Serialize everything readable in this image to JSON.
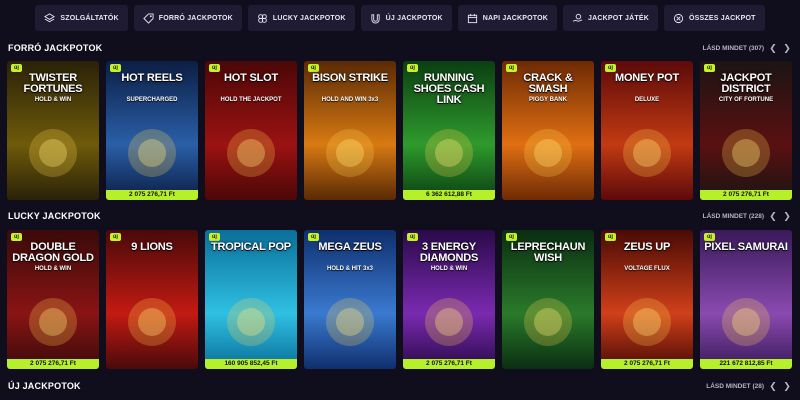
{
  "nav": [
    {
      "label": "SZOLGÁLTATÓK",
      "icon": "layers-icon"
    },
    {
      "label": "FORRÓ JACKPOTOK",
      "icon": "fire-tag-icon"
    },
    {
      "label": "LUCKY JACKPOTOK",
      "icon": "clover-icon"
    },
    {
      "label": "ÚJ JACKPOTOK",
      "icon": "magnet-icon"
    },
    {
      "label": "NAPI JACKPOTOK",
      "icon": "calendar-icon"
    },
    {
      "label": "JACKPOT JÁTÉK",
      "icon": "hand-coin-icon"
    },
    {
      "label": "ÖSSZES JACKPOT",
      "icon": "chip-icon"
    }
  ],
  "sections": [
    {
      "title": "FORRÓ JACKPOTOK",
      "see_all": "LÁSD MINDET (307)",
      "games": [
        {
          "title": "TWISTER FORTUNES",
          "subtitle": "HOLD & WIN",
          "badge": "új",
          "jackpot": "",
          "colors": [
            "#2a2208",
            "#6e5a0a"
          ]
        },
        {
          "title": "HOT REELS",
          "subtitle": "SUPERCHARGED",
          "badge": "új",
          "jackpot": "2 075 276,71 Ft",
          "colors": [
            "#0c1e44",
            "#2a5fa8"
          ]
        },
        {
          "title": "HOT SLOT",
          "subtitle": "HOLD THE JACKPOT",
          "badge": "új",
          "jackpot": "",
          "colors": [
            "#4b0707",
            "#9c1212"
          ]
        },
        {
          "title": "BISON STRIKE",
          "subtitle": "HOLD AND WIN 3x3",
          "badge": "új",
          "jackpot": "",
          "colors": [
            "#5a2a05",
            "#d87a12"
          ]
        },
        {
          "title": "RUNNING SHOES CASH LINK",
          "subtitle": "",
          "badge": "új",
          "jackpot": "6 362 612,88 Ft",
          "colors": [
            "#0b3f12",
            "#2f9a2c"
          ]
        },
        {
          "title": "CRACK & SMASH",
          "subtitle": "PIGGY BANK",
          "badge": "új",
          "jackpot": "",
          "colors": [
            "#6e2a05",
            "#e06f12"
          ]
        },
        {
          "title": "MONEY POT",
          "subtitle": "DELUXE",
          "badge": "új",
          "jackpot": "",
          "colors": [
            "#5c0a0a",
            "#c23a12"
          ]
        },
        {
          "title": "JACKPOT DISTRICT",
          "subtitle": "CITY OF FORTUNE",
          "badge": "új",
          "jackpot": "2 075 276,71 Ft",
          "colors": [
            "#1c1414",
            "#5a1010"
          ]
        }
      ]
    },
    {
      "title": "LUCKY JACKPOTOK",
      "see_all": "LÁSD MINDET (228)",
      "games": [
        {
          "title": "DOUBLE DRAGON GOLD",
          "subtitle": "HOLD & WIN",
          "badge": "új",
          "jackpot": "2 075 276,71 Ft",
          "colors": [
            "#3a0a0a",
            "#8a1414"
          ]
        },
        {
          "title": "9 LIONS",
          "subtitle": "",
          "badge": "új",
          "jackpot": "",
          "colors": [
            "#4a0a0a",
            "#c21a12"
          ]
        },
        {
          "title": "TROPICAL POP",
          "subtitle": "",
          "badge": "új",
          "jackpot": "160 905 852,45 Ft",
          "colors": [
            "#0a6f9a",
            "#2fc0e2"
          ]
        },
        {
          "title": "MEGA ZEUS",
          "subtitle": "HOLD & HIT 3x3",
          "badge": "új",
          "jackpot": "",
          "colors": [
            "#0f2f6e",
            "#3a7ad0"
          ]
        },
        {
          "title": "3 ENERGY DIAMONDS",
          "subtitle": "HOLD & WIN",
          "badge": "új",
          "jackpot": "2 075 276,71 Ft",
          "colors": [
            "#2a0a4a",
            "#7a2ab0"
          ]
        },
        {
          "title": "LEPRECHAUN WISH",
          "subtitle": "",
          "badge": "új",
          "jackpot": "",
          "colors": [
            "#0a2e12",
            "#2a7a2a"
          ]
        },
        {
          "title": "ZEUS UP",
          "subtitle": "VOLTAGE FLUX",
          "badge": "új",
          "jackpot": "2 075 276,71 Ft",
          "colors": [
            "#4a0a05",
            "#d0401a"
          ]
        },
        {
          "title": "PIXEL SAMURAI",
          "subtitle": "",
          "badge": "új",
          "jackpot": "221 672 812,85 Ft",
          "colors": [
            "#3a1a5a",
            "#8a4ab0"
          ]
        }
      ]
    },
    {
      "title": "ÚJ JACKPOTOK",
      "see_all": "LÁSD MINDET (28)"
    }
  ]
}
